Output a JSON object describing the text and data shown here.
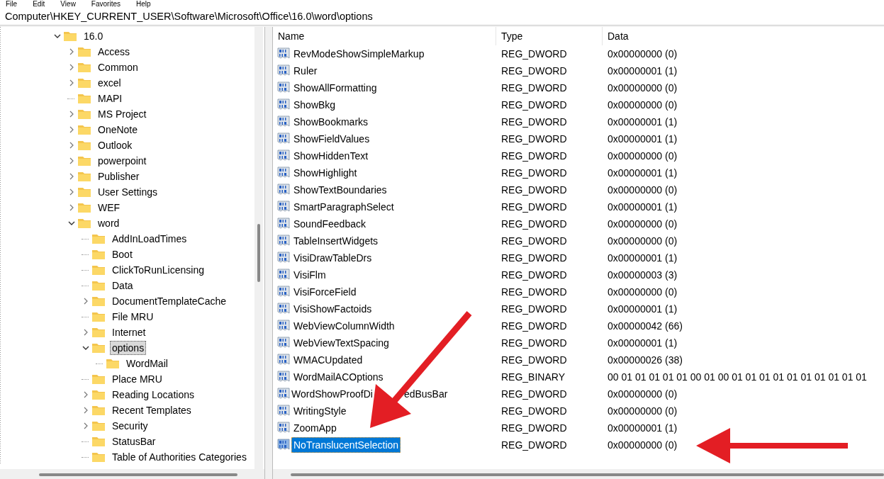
{
  "menu": [
    "File",
    "Edit",
    "View",
    "Favorites",
    "Help"
  ],
  "address": "Computer\\HKEY_CURRENT_USER\\Software\\Microsoft\\Office\\16.0\\word\\options",
  "tree": [
    {
      "label": "16.0",
      "kind": "branch",
      "expanded": true,
      "selected": false,
      "children": [
        {
          "label": "Access",
          "kind": "branch",
          "expanded": false,
          "selected": false
        },
        {
          "label": "Common",
          "kind": "branch",
          "expanded": false,
          "selected": false
        },
        {
          "label": "excel",
          "kind": "branch",
          "expanded": false,
          "selected": false
        },
        {
          "label": "MAPI",
          "kind": "leaf",
          "selected": false
        },
        {
          "label": "MS Project",
          "kind": "branch",
          "expanded": false,
          "selected": false
        },
        {
          "label": "OneNote",
          "kind": "branch",
          "expanded": false,
          "selected": false
        },
        {
          "label": "Outlook",
          "kind": "branch",
          "expanded": false,
          "selected": false
        },
        {
          "label": "powerpoint",
          "kind": "branch",
          "expanded": false,
          "selected": false
        },
        {
          "label": "Publisher",
          "kind": "branch",
          "expanded": false,
          "selected": false
        },
        {
          "label": "User Settings",
          "kind": "branch",
          "expanded": false,
          "selected": false
        },
        {
          "label": "WEF",
          "kind": "branch",
          "expanded": false,
          "selected": false
        },
        {
          "label": "word",
          "kind": "branch",
          "expanded": true,
          "selected": false,
          "children": [
            {
              "label": "AddInLoadTimes",
              "kind": "leaf",
              "selected": false
            },
            {
              "label": "Boot",
              "kind": "leaf",
              "selected": false
            },
            {
              "label": "ClickToRunLicensing",
              "kind": "leaf",
              "selected": false
            },
            {
              "label": "Data",
              "kind": "leaf",
              "selected": false
            },
            {
              "label": "DocumentTemplateCache",
              "kind": "branch",
              "expanded": false,
              "selected": false
            },
            {
              "label": "File MRU",
              "kind": "leaf",
              "selected": false
            },
            {
              "label": "Internet",
              "kind": "branch",
              "expanded": false,
              "selected": false
            },
            {
              "label": "options",
              "kind": "branch",
              "expanded": true,
              "selected": true,
              "children": [
                {
                  "label": "WordMail",
                  "kind": "leaf",
                  "selected": false
                }
              ]
            },
            {
              "label": "Place MRU",
              "kind": "leaf",
              "selected": false
            },
            {
              "label": "Reading Locations",
              "kind": "branch",
              "expanded": false,
              "selected": false
            },
            {
              "label": "Recent Templates",
              "kind": "branch",
              "expanded": false,
              "selected": false
            },
            {
              "label": "Security",
              "kind": "branch",
              "expanded": false,
              "selected": false
            },
            {
              "label": "StatusBar",
              "kind": "leaf",
              "selected": false
            },
            {
              "label": "Table of Authorities Categories",
              "kind": "leaf",
              "selected": false
            }
          ]
        }
      ]
    }
  ],
  "columns": [
    "Name",
    "Type",
    "Data"
  ],
  "values": [
    {
      "name": "RevModeShowSimpleMarkup",
      "type": "REG_DWORD",
      "data": "0x00000000 (0)",
      "selected": false
    },
    {
      "name": "Ruler",
      "type": "REG_DWORD",
      "data": "0x00000001 (1)",
      "selected": false
    },
    {
      "name": "ShowAllFormatting",
      "type": "REG_DWORD",
      "data": "0x00000000 (0)",
      "selected": false
    },
    {
      "name": "ShowBkg",
      "type": "REG_DWORD",
      "data": "0x00000000 (0)",
      "selected": false
    },
    {
      "name": "ShowBookmarks",
      "type": "REG_DWORD",
      "data": "0x00000001 (1)",
      "selected": false
    },
    {
      "name": "ShowFieldValues",
      "type": "REG_DWORD",
      "data": "0x00000001 (1)",
      "selected": false
    },
    {
      "name": "ShowHiddenText",
      "type": "REG_DWORD",
      "data": "0x00000000 (0)",
      "selected": false
    },
    {
      "name": "ShowHighlight",
      "type": "REG_DWORD",
      "data": "0x00000001 (1)",
      "selected": false
    },
    {
      "name": "ShowTextBoundaries",
      "type": "REG_DWORD",
      "data": "0x00000000 (0)",
      "selected": false
    },
    {
      "name": "SmartParagraphSelect",
      "type": "REG_DWORD",
      "data": "0x00000001 (1)",
      "selected": false
    },
    {
      "name": "SoundFeedback",
      "type": "REG_DWORD",
      "data": "0x00000000 (0)",
      "selected": false
    },
    {
      "name": "TableInsertWidgets",
      "type": "REG_DWORD",
      "data": "0x00000000 (0)",
      "selected": false
    },
    {
      "name": "VisiDrawTableDrs",
      "type": "REG_DWORD",
      "data": "0x00000001 (1)",
      "selected": false
    },
    {
      "name": "VisiFlm",
      "type": "REG_DWORD",
      "data": "0x00000003 (3)",
      "selected": false
    },
    {
      "name": "VisiForceField",
      "type": "REG_DWORD",
      "data": "0x00000000 (0)",
      "selected": false
    },
    {
      "name": "VisiShowFactoids",
      "type": "REG_DWORD",
      "data": "0x00000001 (1)",
      "selected": false
    },
    {
      "name": "WebViewColumnWidth",
      "type": "REG_DWORD",
      "data": "0x00000042 (66)",
      "selected": false
    },
    {
      "name": "WebViewTextSpacing",
      "type": "REG_DWORD",
      "data": "0x00000001 (1)",
      "selected": false
    },
    {
      "name": "WMACUpdated",
      "type": "REG_DWORD",
      "data": "0x00000026 (38)",
      "selected": false
    },
    {
      "name": "WordMailACOptions",
      "type": "REG_BINARY",
      "data": "00 01 01 01 01 01 00 01 00 01 01 01 01 01 01 01 01 01 01",
      "selected": false
    },
    {
      "name_parts": [
        "WordShowProofDi",
        "edBusBar"
      ],
      "type": "REG_DWORD",
      "data": "0x00000000 (0)",
      "selected": false
    },
    {
      "name": "WritingStyle",
      "type": "REG_DWORD",
      "data": "0x00000000 (0)",
      "selected": false
    },
    {
      "name": "ZoomApp",
      "type": "REG_DWORD",
      "data": "0x00000001 (1)",
      "selected": false
    },
    {
      "name": "NoTranslucentSelection",
      "type": "REG_DWORD",
      "data": "0x00000000 (0)",
      "selected": true
    }
  ]
}
